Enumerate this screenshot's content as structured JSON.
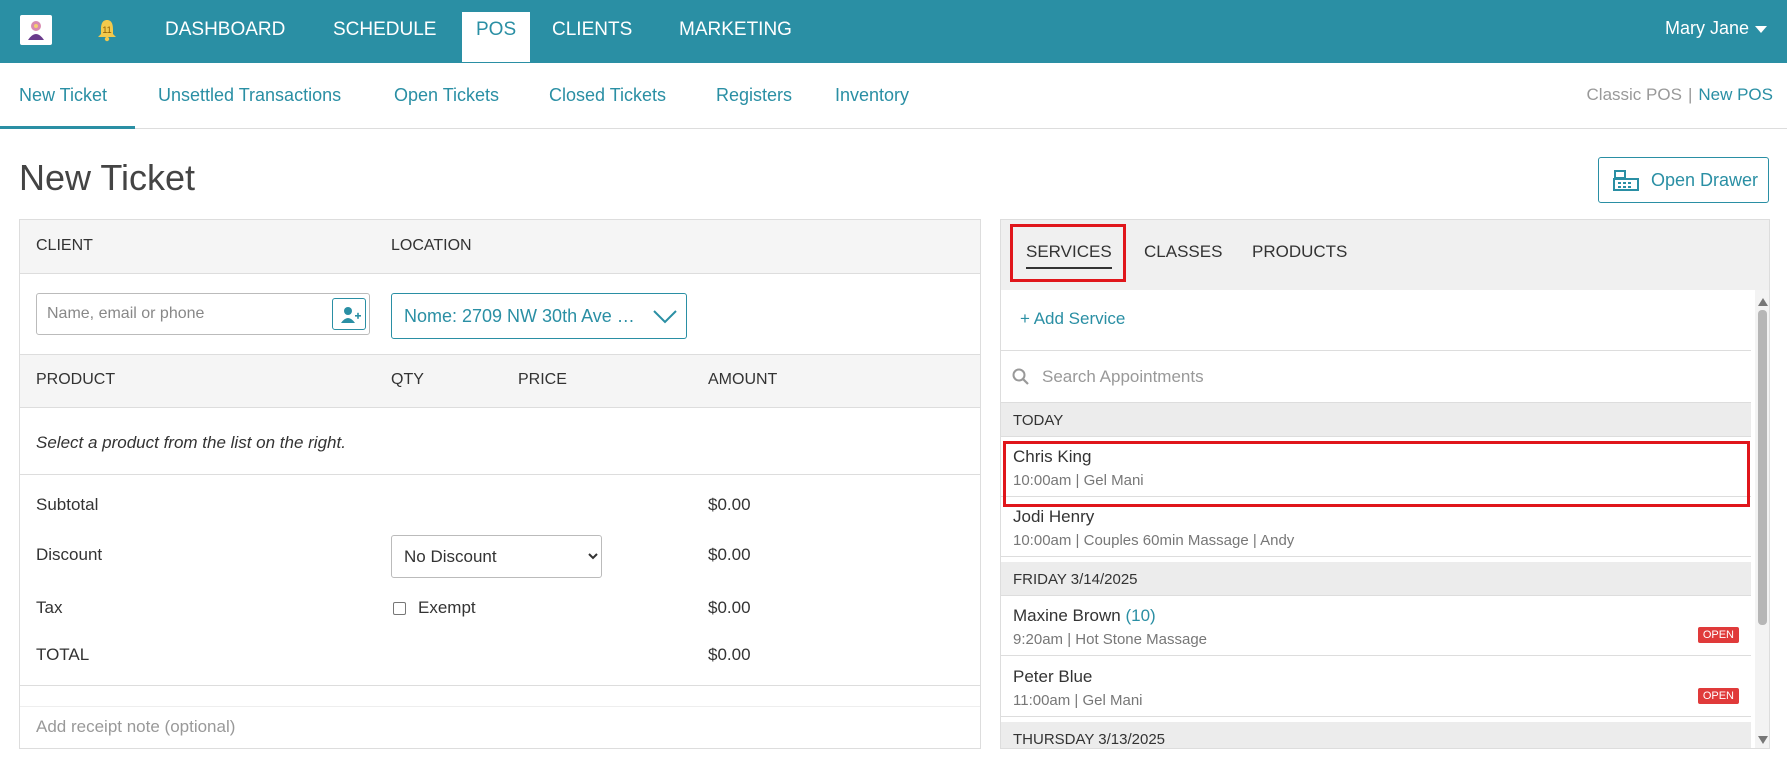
{
  "topnav": {
    "items": [
      {
        "label": "DASHBOARD"
      },
      {
        "label": "SCHEDULE"
      },
      {
        "label": "POS",
        "active": true
      },
      {
        "label": "CLIENTS"
      },
      {
        "label": "MARKETING"
      }
    ],
    "user_name": "Mary Jane",
    "brand_color": "#2a8fa4"
  },
  "subnav": {
    "items": [
      {
        "label": "New Ticket",
        "active": true
      },
      {
        "label": "Unsettled Transactions"
      },
      {
        "label": "Open Tickets"
      },
      {
        "label": "Closed Tickets"
      },
      {
        "label": "Registers"
      },
      {
        "label": "Inventory"
      }
    ],
    "classic_pos": "Classic POS",
    "separator": "|",
    "new_pos": "New POS"
  },
  "page": {
    "title": "New Ticket",
    "open_drawer_label": "Open Drawer"
  },
  "ticket": {
    "client_header": "CLIENT",
    "location_header": "LOCATION",
    "client_placeholder": "Name, email or phone",
    "location_value": "Nome: 2709 NW 30th Ave …",
    "columns": {
      "product": "PRODUCT",
      "qty": "QTY",
      "price": "PRICE",
      "amount": "AMOUNT"
    },
    "empty_message": "Select a product from the list on the right.",
    "subtotal_label": "Subtotal",
    "subtotal_value": "$0.00",
    "discount_label": "Discount",
    "discount_option": "No Discount",
    "discount_value": "$0.00",
    "tax_label": "Tax",
    "exempt_label": "Exempt",
    "tax_value": "$0.00",
    "total_label": "TOTAL",
    "total_value": "$0.00",
    "receipt_placeholder": "Add receipt note (optional)"
  },
  "catalog": {
    "tabs": [
      {
        "label": "SERVICES",
        "active": true
      },
      {
        "label": "CLASSES"
      },
      {
        "label": "PRODUCTS"
      }
    ],
    "add_service": "+ Add Service",
    "search_placeholder": "Search Appointments",
    "groups": [
      {
        "header": "TODAY",
        "appointments": [
          {
            "name": "Chris King",
            "detail": "10:00am | Gel Mani",
            "highlighted": true
          },
          {
            "name": "Jodi Henry",
            "detail": "10:00am | Couples 60min Massage | Andy"
          }
        ]
      },
      {
        "header": "FRIDAY 3/14/2025",
        "appointments": [
          {
            "name": "Maxine Brown",
            "count": "(10)",
            "detail": "9:20am | Hot Stone Massage",
            "badge": "OPEN"
          },
          {
            "name": "Peter Blue",
            "detail": "11:00am | Gel Mani",
            "badge": "OPEN"
          }
        ]
      },
      {
        "header": "THURSDAY 3/13/2025",
        "appointments": []
      }
    ]
  }
}
